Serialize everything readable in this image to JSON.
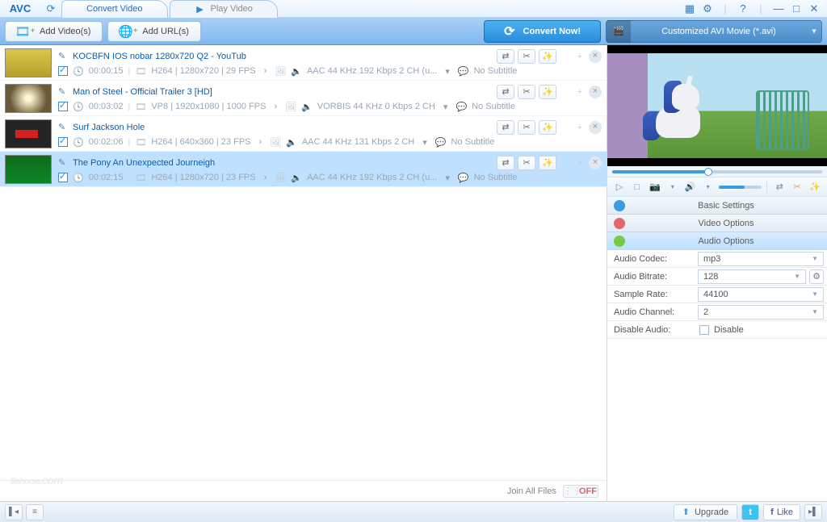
{
  "app": {
    "logo": "AVC"
  },
  "tabs": {
    "convert": "Convert Video",
    "play": "Play Video"
  },
  "toolbar": {
    "add_videos": "Add Video(s)",
    "add_urls": "Add URL(s)",
    "convert_now": "Convert Now!",
    "profile_label": "Customized AVI Movie (*.avi)"
  },
  "items": [
    {
      "title": "KOCBFN IOS nobar 1280x720 Q2 - YouTub",
      "duration": "00:00:15",
      "video_info": "H264 | 1280x720 | 29 FPS",
      "audio_info": "AAC 44 KHz 192 Kbps 2 CH (u...",
      "subtitle": "No Subtitle",
      "thumb_class": "yel",
      "selected": false
    },
    {
      "title": "Man of Steel - Official Trailer 3 [HD]",
      "duration": "00:03:02",
      "video_info": "VP8 | 1920x1080 | 1000 FPS",
      "audio_info": "VORBIS 44 KHz 0 Kbps 2 CH",
      "subtitle": "No Subtitle",
      "thumb_class": "flare",
      "selected": false
    },
    {
      "title": "Surf Jackson Hole",
      "duration": "00:02:06",
      "video_info": "H264 | 640x360 | 23 FPS",
      "audio_info": "AAC 44 KHz 131 Kbps 2 CH",
      "subtitle": "No Subtitle",
      "thumb_class": "red",
      "selected": false
    },
    {
      "title": "The Pony An Unexpected Journeigh",
      "duration": "00:02:15",
      "video_info": "H264 | 1280x720 | 23 FPS",
      "audio_info": "AAC 44 KHz 192 Kbps 2 CH (u...",
      "subtitle": "No Subtitle",
      "thumb_class": "green",
      "selected": true
    }
  ],
  "list_footer": {
    "join_all": "Join All Files",
    "toggle": "OFF"
  },
  "settings": {
    "basic": "Basic Settings",
    "video": "Video Options",
    "audio": "Audio Options",
    "rows": {
      "codec_label": "Audio Codec:",
      "codec_value": "mp3",
      "bitrate_label": "Audio Bitrate:",
      "bitrate_value": "128",
      "sample_label": "Sample Rate:",
      "sample_value": "44100",
      "channel_label": "Audio Channel:",
      "channel_value": "2",
      "disable_label": "Disable Audio:",
      "disable_text": "Disable"
    }
  },
  "statusbar": {
    "upgrade": "Upgrade",
    "like": "Like"
  },
  "watermark": {
    "main": "filehorse",
    "com": ".com"
  }
}
